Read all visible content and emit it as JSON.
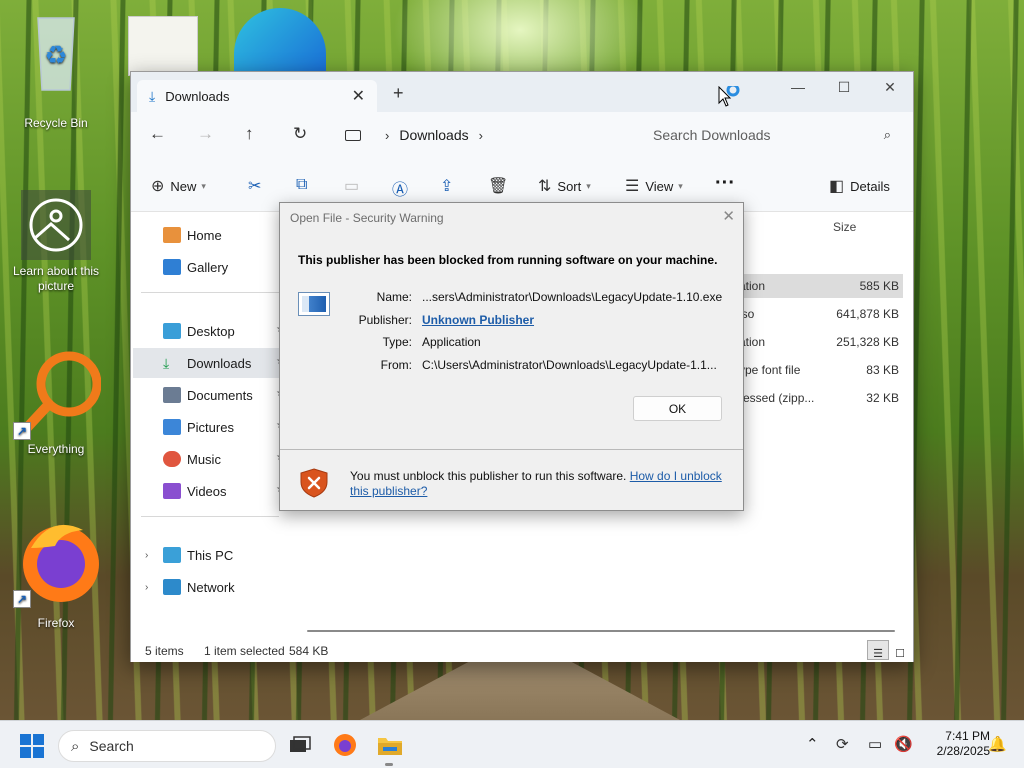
{
  "desktop": {
    "icons": [
      {
        "label": "Recycle Bin",
        "icon": "recycle-bin-icon"
      },
      {
        "label": "Learn about this picture",
        "icon": "learn-picture-icon"
      },
      {
        "label": "Everything",
        "icon": "everything-search-icon"
      },
      {
        "label": "Firefox",
        "icon": "firefox-icon"
      }
    ]
  },
  "explorer": {
    "tab_title": "Downloads",
    "breadcrumb": [
      "Downloads"
    ],
    "search_placeholder": "Search Downloads",
    "commands": {
      "new": "New",
      "sort": "Sort",
      "view": "View",
      "details": "Details"
    },
    "nav": {
      "home": "Home",
      "gallery": "Gallery",
      "desktop": "Desktop",
      "downloads": "Downloads",
      "documents": "Documents",
      "pictures": "Pictures",
      "music": "Music",
      "videos": "Videos",
      "this_pc": "This PC",
      "network": "Network"
    },
    "columns": {
      "size": "Size"
    },
    "rows": [
      {
        "type": "ation",
        "size": "585 KB",
        "selected": true
      },
      {
        "type": "iso",
        "size": "641,878 KB",
        "selected": false
      },
      {
        "type": "ation",
        "size": "251,328 KB",
        "selected": false
      },
      {
        "type": "ype font file",
        "size": "83 KB",
        "selected": false
      },
      {
        "type": "ressed (zipp...",
        "size": "32 KB",
        "selected": false
      }
    ],
    "status": {
      "items": "5 items",
      "selected": "1 item selected",
      "selected_size": "584 KB"
    }
  },
  "dialog": {
    "title": "Open File - Security Warning",
    "heading": "This publisher has been blocked from running software on your machine.",
    "fields": {
      "name_label": "Name:",
      "name_value": "...sers\\Administrator\\Downloads\\LegacyUpdate-1.10.exe",
      "publisher_label": "Publisher:",
      "publisher_value": "Unknown Publisher",
      "type_label": "Type:",
      "type_value": "Application",
      "from_label": "From:",
      "from_value": "C:\\Users\\Administrator\\Downloads\\LegacyUpdate-1.1..."
    },
    "ok_label": "OK",
    "footer_text": "You must unblock this publisher to run this software.",
    "footer_link": "How do I unblock this publisher?"
  },
  "taskbar": {
    "search_label": "Search",
    "time": "7:41 PM",
    "date": "2/28/2025"
  },
  "colors": {
    "accent": "#1a74d3",
    "link": "#1d5ca8",
    "shield": "#d9541e"
  }
}
